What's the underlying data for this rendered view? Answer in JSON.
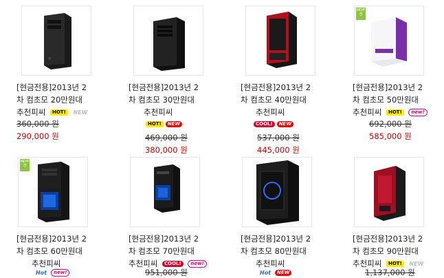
{
  "products": [
    {
      "line1": "[현금전용]2013년 2",
      "line2": "차 컴초모 20만원대",
      "line3": "추천피씨",
      "badges": [
        "HOT!",
        "NEW"
      ],
      "old_price": "360,000 원",
      "price": "290,000 원"
    },
    {
      "line1": "[현금전용]2013년 2",
      "line2": "차 컴초모 30만원대",
      "line3": "추천피씨",
      "badges": [
        "HOT!",
        "NEW"
      ],
      "old_price": "469,000 원",
      "price": "380,000 원"
    },
    {
      "line1": "[현금전용]2013년 2",
      "line2": "차 컴초모 40만원대",
      "line3": "추천피씨",
      "badges": [
        "COOL!",
        "NEW"
      ],
      "old_price": "537,000 원",
      "price": "445,000 원"
    },
    {
      "line1": "[현금전용]2013년 2",
      "line2": "차 컴초모 50만원대",
      "line3": "추천피씨",
      "badges": [
        "HOT!",
        "new!"
      ],
      "old_price": "692,000 원",
      "price": "585,000 원"
    },
    {
      "line1": "[현금전용]2013년 2",
      "line2": "차 컴초모 60만원대",
      "line3": "추천피씨",
      "badges": [
        "Hot",
        "new!"
      ],
      "old_price": "",
      "price": ""
    },
    {
      "line1": "[현금전용]2013년 2",
      "line2": "차 컴초모 70만원대",
      "line3": "추천피씨",
      "badges": [
        "COOL!",
        "new!"
      ],
      "old_price": "951,000 원",
      "price": ""
    },
    {
      "line1": "[현금전용]2013년 2",
      "line2": "차 컴초모 80만원대",
      "line3": "추천피씨",
      "badges": [
        "Hot",
        "NEW"
      ],
      "old_price": "",
      "price": ""
    },
    {
      "line1": "[현금전용]2013년 2",
      "line2": "차 컴초모 90만원대",
      "line3": "추천피씨",
      "badges": [
        "HOT!",
        "NEW"
      ],
      "old_price": "1,137,000 원",
      "price": ""
    }
  ],
  "md_tag": "MD추천",
  "colors": {
    "price": "#cc0000",
    "hot": "#ffea00",
    "cool": "#d8002c",
    "new_red": "#ee0000",
    "new_pink": "#e6007e"
  }
}
